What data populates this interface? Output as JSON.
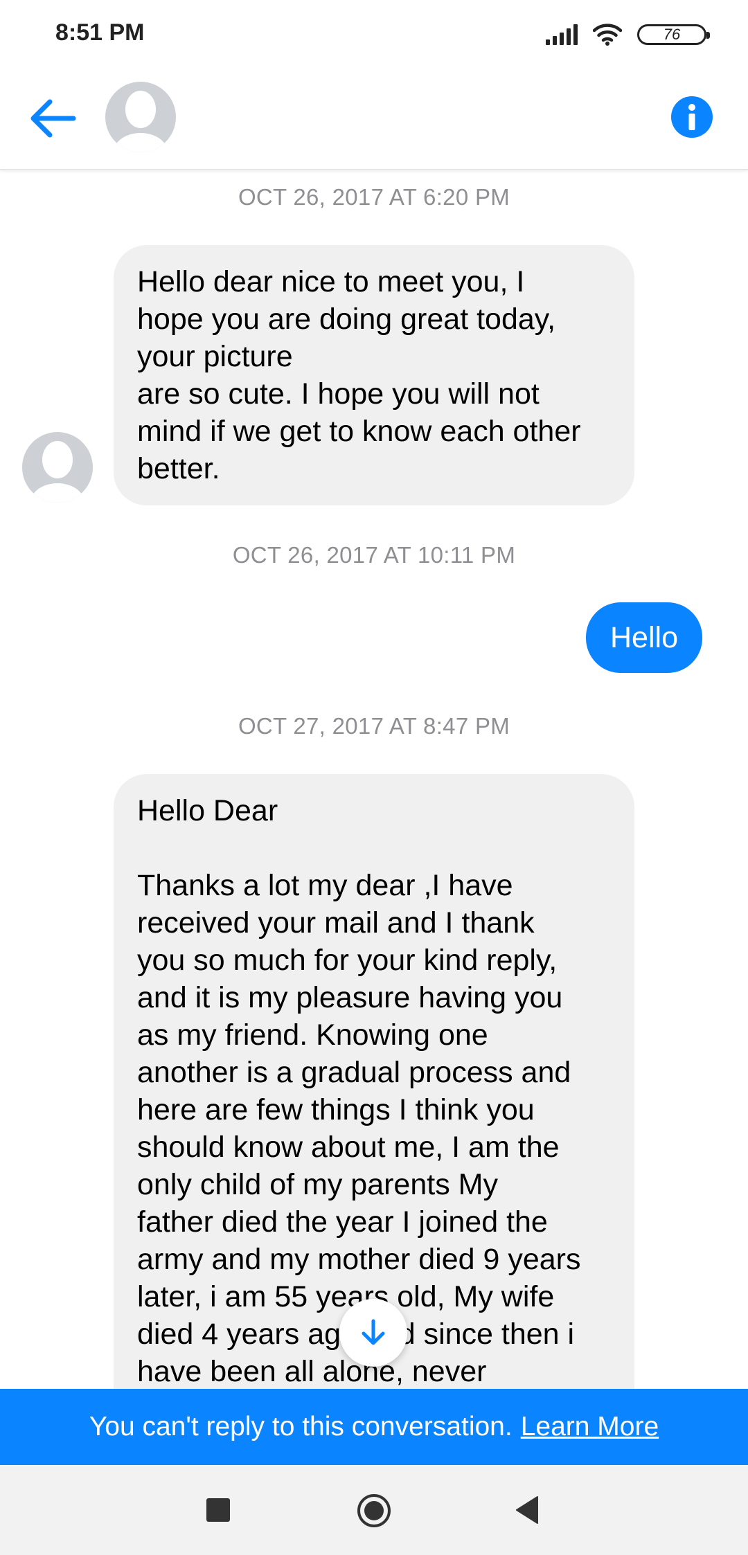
{
  "status_bar": {
    "time": "8:51 PM",
    "battery": "76"
  },
  "header": {
    "back_icon": "arrow-left-icon",
    "avatar": "default-avatar",
    "info_icon": "info-icon"
  },
  "messages": [
    {
      "timestamp": "OCT 26, 2017 AT 6:20 PM"
    },
    {
      "direction": "incoming",
      "text": "Hello dear nice to meet you, I\nhope you are doing great today,\nyour picture\nare so cute. I hope you will not\nmind if we get to know each other\nbetter."
    },
    {
      "timestamp": "OCT 26, 2017 AT 10:11 PM"
    },
    {
      "direction": "outgoing",
      "text": "Hello"
    },
    {
      "timestamp": "OCT 27, 2017 AT 8:47 PM"
    },
    {
      "direction": "incoming",
      "text": "Hello Dear\n\nThanks a lot my dear ,I have\nreceived your mail and I thank\nyou so much for your kind reply,\nand it is my pleasure having you\nas my friend. Knowing one\nanother is a gradual process and\nhere are few things I think you\nshould know about me, I am the\nonly child of my parents My\nfather died the year I joined the\narmy and my mother died 9 years\nlater, i am 55 years old, My wife\ndied 4 years ago and since then i\nhave been all alone, never"
    }
  ],
  "banner": {
    "text": "You can't reply to this conversation.",
    "link": "Learn More"
  },
  "colors": {
    "accent": "#0a84ff",
    "bubble_in": "#f0f0f0",
    "timestamp": "#8e8e93"
  }
}
